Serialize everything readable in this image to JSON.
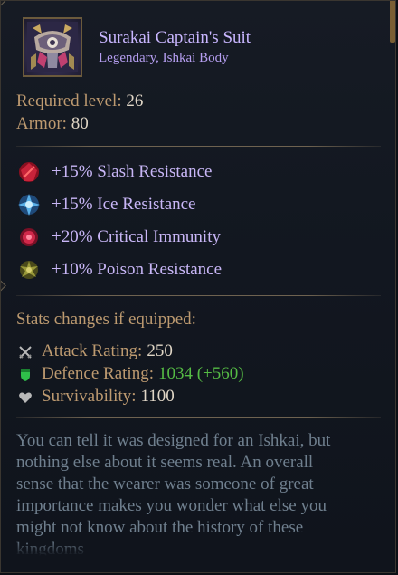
{
  "item": {
    "name": "Surakai Captain's Suit",
    "subtitle": "Legendary, Ishkai Body",
    "icon": "armor-suit-icon"
  },
  "requirements": {
    "level_label": "Required level:",
    "level_value": "26",
    "armor_label": "Armor:",
    "armor_value": "80"
  },
  "modifiers": [
    {
      "text": "+15% Slash Resistance",
      "icon": "slash-resistance-icon",
      "color": "#c8233a"
    },
    {
      "text": "+15% Ice Resistance",
      "icon": "ice-resistance-icon",
      "color": "#5ab0e8"
    },
    {
      "text": "+20% Critical Immunity",
      "icon": "critical-immunity-icon",
      "color": "#d0284a"
    },
    {
      "text": "+10% Poison Resistance",
      "icon": "poison-resistance-icon",
      "color": "#9a9a3a"
    }
  ],
  "stats": {
    "title": "Stats changes if equipped:",
    "attack": {
      "label": "Attack Rating:",
      "value": "250",
      "icon": "crossed-swords-icon"
    },
    "defence": {
      "label": "Defence Rating:",
      "value": "1034 (+560)",
      "icon": "shield-icon",
      "value_color": "#55bb44"
    },
    "survivability": {
      "label": "Survivability:",
      "value": "1100",
      "icon": "heart-icon"
    }
  },
  "description": {
    "lines": [
      "You can tell it was designed for an Ishkai, but",
      "nothing else about it seems real. An overall",
      "sense that the wearer was someone of great",
      "importance makes you wonder what else you",
      "might not know about the history of these",
      "kingdoms"
    ]
  }
}
